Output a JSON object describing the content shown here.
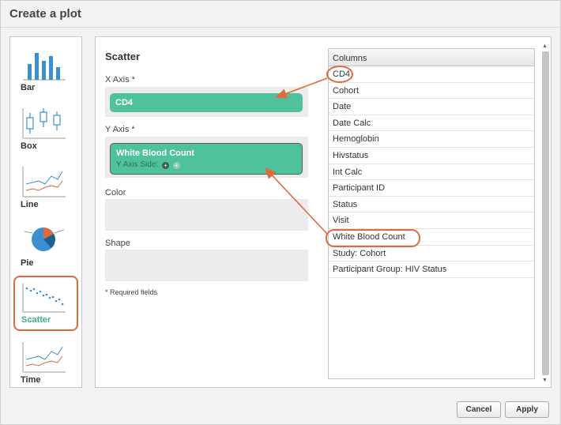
{
  "dialog": {
    "title": "Create a plot"
  },
  "chart_types": [
    {
      "label": "Bar",
      "icon": "bar-chart-icon"
    },
    {
      "label": "Box",
      "icon": "box-plot-icon"
    },
    {
      "label": "Line",
      "icon": "line-chart-icon"
    },
    {
      "label": "Pie",
      "icon": "pie-chart-icon"
    },
    {
      "label": "Scatter",
      "icon": "scatter-plot-icon",
      "selected": true
    },
    {
      "label": "Time",
      "icon": "time-chart-icon"
    }
  ],
  "panel": {
    "title": "Scatter",
    "x_axis": {
      "label": "X Axis *",
      "value": "CD4"
    },
    "y_axis": {
      "label": "Y Axis *",
      "value": "White Blood Count",
      "side_label": "Y Axis Side:"
    },
    "color": {
      "label": "Color"
    },
    "shape": {
      "label": "Shape"
    },
    "required_note": "* Required fields"
  },
  "columns": {
    "header": "Columns",
    "items": [
      "CD4",
      "Cohort",
      "Date",
      "Date Calc",
      "Hemoglobin",
      "Hivstatus",
      "Int Calc",
      "Participant ID",
      "Status",
      "Visit",
      "White Blood Count",
      "Study: Cohort",
      "Participant Group: HIV Status"
    ]
  },
  "buttons": {
    "cancel": "Cancel",
    "apply": "Apply"
  },
  "colors": {
    "accent_green": "#4fc19c",
    "highlight_orange": "#e06a3a"
  }
}
